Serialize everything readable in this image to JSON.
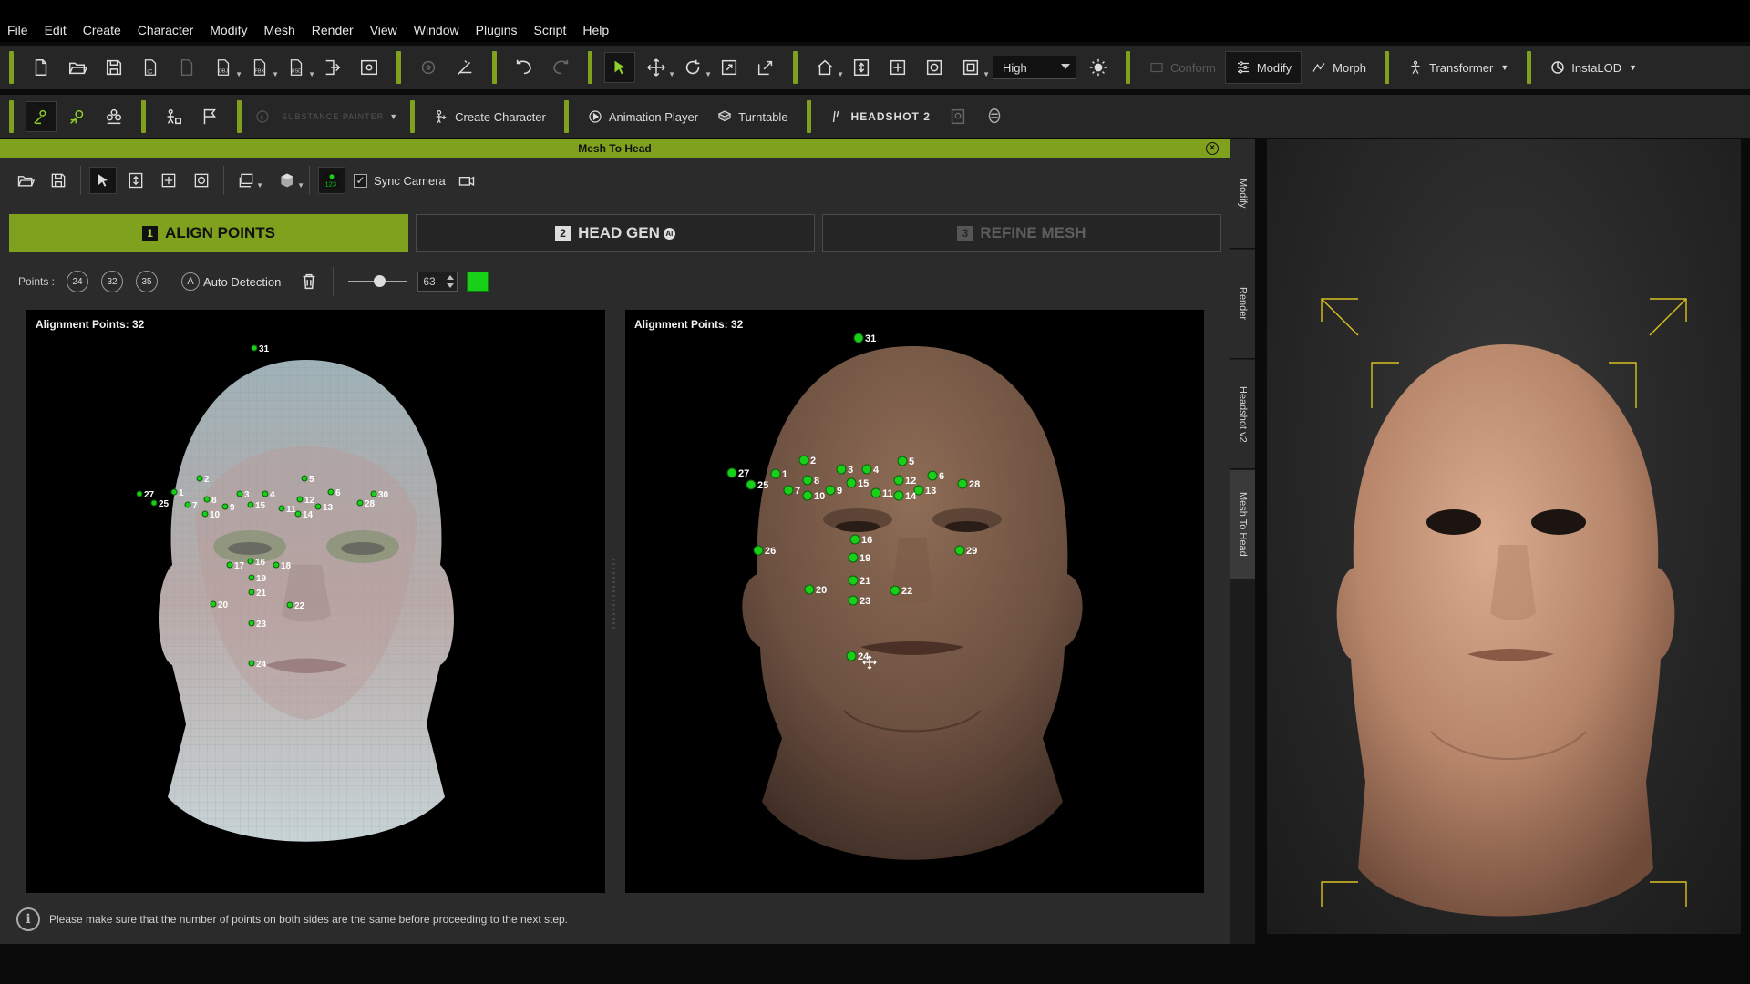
{
  "menubar": {
    "items": [
      "File",
      "Edit",
      "Create",
      "Character",
      "Modify",
      "Mesh",
      "Render",
      "View",
      "Window",
      "Plugins",
      "Script",
      "Help"
    ]
  },
  "toolbar1": {
    "quality_value": "High",
    "conform_label": "Conform",
    "modify_label": "Modify",
    "morph_label": "Morph",
    "transformer_label": "Transformer",
    "instalod_label": "InstaLOD"
  },
  "toolbar2": {
    "substance_label": "SUBSTANCE PAINTER",
    "create_character_label": "Create Character",
    "animation_player_label": "Animation Player",
    "turntable_label": "Turntable",
    "headshot_label": "HEADSHOT 2"
  },
  "panel": {
    "title": "Mesh To Head",
    "sync_camera_label": "Sync Camera",
    "steps": [
      {
        "num": "1",
        "label": "ALIGN POINTS",
        "state": "active"
      },
      {
        "num": "2",
        "label": "HEAD GEN",
        "state": "normal"
      },
      {
        "num": "3",
        "label": "REFINE MESH",
        "state": "disabled"
      }
    ],
    "points_label": "Points :",
    "point_presets": [
      "24",
      "32",
      "35"
    ],
    "auto_detection_label": "Auto Detection",
    "point_size_value": "63",
    "point_size_fraction": 0.55,
    "point_color": "#17d017",
    "left_view": {
      "caption": "Alignment Points: 32"
    },
    "right_view": {
      "caption": "Alignment Points: 32"
    },
    "info_text": "Please make sure that the number of points on both sides are the same before proceeding to the next step."
  },
  "landmarks": {
    "left": [
      {
        "n": "1"
      },
      {
        "n": "2"
      },
      {
        "n": "3"
      },
      {
        "n": "4"
      },
      {
        "n": "5"
      },
      {
        "n": "6"
      },
      {
        "n": "7"
      },
      {
        "n": "8"
      },
      {
        "n": "9"
      },
      {
        "n": "10"
      },
      {
        "n": "11"
      },
      {
        "n": "12"
      },
      {
        "n": "13"
      },
      {
        "n": "14"
      },
      {
        "n": "15"
      },
      {
        "n": "16"
      },
      {
        "n": "17"
      },
      {
        "n": "18"
      },
      {
        "n": "19"
      },
      {
        "n": "20"
      },
      {
        "n": "21"
      },
      {
        "n": "22"
      },
      {
        "n": "23"
      },
      {
        "n": "24"
      },
      {
        "n": "25"
      },
      {
        "n": "27"
      },
      {
        "n": "28"
      },
      {
        "n": "30"
      },
      {
        "n": "31"
      }
    ],
    "right": [
      {
        "n": "1"
      },
      {
        "n": "2"
      },
      {
        "n": "3"
      },
      {
        "n": "4"
      },
      {
        "n": "5"
      },
      {
        "n": "6"
      },
      {
        "n": "7"
      },
      {
        "n": "8"
      },
      {
        "n": "9"
      },
      {
        "n": "10"
      },
      {
        "n": "11"
      },
      {
        "n": "12"
      },
      {
        "n": "13"
      },
      {
        "n": "14"
      },
      {
        "n": "15"
      },
      {
        "n": "16"
      },
      {
        "n": "19"
      },
      {
        "n": "20"
      },
      {
        "n": "21"
      },
      {
        "n": "22"
      },
      {
        "n": "23"
      },
      {
        "n": "24"
      },
      {
        "n": "25"
      },
      {
        "n": "26"
      },
      {
        "n": "27"
      },
      {
        "n": "28"
      },
      {
        "n": "29"
      },
      {
        "n": "31"
      }
    ]
  },
  "side_tabs": [
    "Modify",
    "Render",
    "Headshot v2",
    "Mesh To Head"
  ],
  "colors": {
    "accent": "#7fa11d",
    "point": "#17d017",
    "preview_frame": "#d9c21f"
  }
}
